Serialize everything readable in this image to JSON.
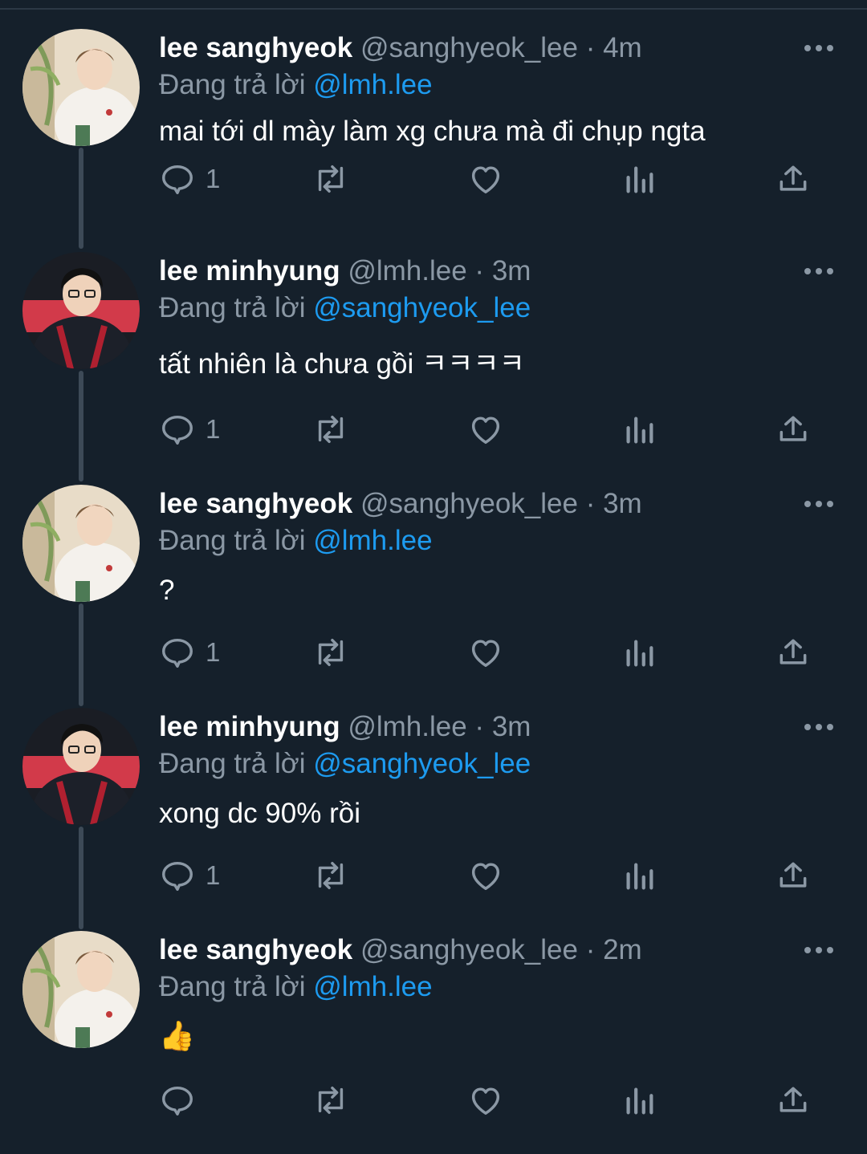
{
  "tweets": [
    {
      "name": "lee sanghyeok",
      "handle": "@sanghyeok_lee",
      "separator": "·",
      "time": "4m",
      "reply_prefix": "Đang trả lời",
      "reply_to": "@lmh.lee",
      "text": "mai tới dl mày làm xg chưa mà đi chụp ngta",
      "reply_count": "1",
      "avatar": "avatar-sanghyeok"
    },
    {
      "name": "lee minhyung",
      "handle": "@lmh.lee",
      "separator": "·",
      "time": "3m",
      "reply_prefix": "Đang trả lời",
      "reply_to": "@sanghyeok_lee",
      "text": "tất nhiên là chưa gồi ㅋㅋㅋㅋ",
      "reply_count": "1",
      "avatar": "avatar-minhyung"
    },
    {
      "name": "lee sanghyeok",
      "handle": "@sanghyeok_lee",
      "separator": "·",
      "time": "3m",
      "reply_prefix": "Đang trả lời",
      "reply_to": "@lmh.lee",
      "text": "?",
      "reply_count": "1",
      "avatar": "avatar-sanghyeok"
    },
    {
      "name": "lee minhyung",
      "handle": "@lmh.lee",
      "separator": "·",
      "time": "3m",
      "reply_prefix": "Đang trả lời",
      "reply_to": "@sanghyeok_lee",
      "text": "xong dc 90% rồi",
      "reply_count": "1",
      "avatar": "avatar-minhyung"
    },
    {
      "name": "lee sanghyeok",
      "handle": "@sanghyeok_lee",
      "separator": "·",
      "time": "2m",
      "reply_prefix": "Đang trả lời",
      "reply_to": "@lmh.lee",
      "text": "👍",
      "reply_count": "",
      "avatar": "avatar-sanghyeok"
    }
  ],
  "icons": {
    "reply": "reply-icon",
    "retweet": "retweet-icon",
    "like": "heart-icon",
    "views": "analytics-icon",
    "share": "share-icon",
    "more": "more-icon"
  },
  "colors": {
    "background": "#15202b",
    "secondary_text": "#8b98a5",
    "link": "#1d9bf0",
    "thread_line": "#3d4a57"
  }
}
